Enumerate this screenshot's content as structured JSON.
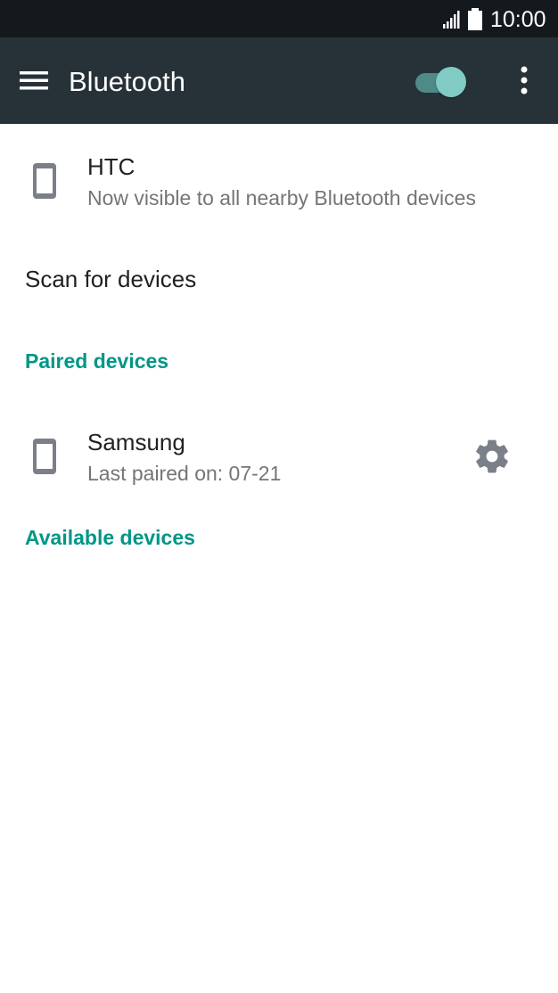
{
  "status_bar": {
    "time": "10:00",
    "signal_icon": "signal-icon",
    "battery_icon": "battery-icon"
  },
  "app_bar": {
    "title": "Bluetooth",
    "menu_icon": "hamburger-menu-icon",
    "overflow_icon": "more-vert-icon",
    "bluetooth_enabled": true,
    "toggle_color": "#80cbc4",
    "background_color": "#263238"
  },
  "this_device": {
    "name": "HTC",
    "status": "Now visible to all nearby Bluetooth devices",
    "icon": "phone-icon"
  },
  "scan": {
    "label": "Scan for devices"
  },
  "paired_section": {
    "header": "Paired devices",
    "devices": [
      {
        "name": "Samsung",
        "detail": "Last paired on: 07-21",
        "icon": "phone-icon",
        "settings_icon": "gear-icon"
      }
    ]
  },
  "available_section": {
    "header": "Available devices"
  },
  "colors": {
    "accent": "#009688",
    "icon_gray": "#7b7f88"
  }
}
